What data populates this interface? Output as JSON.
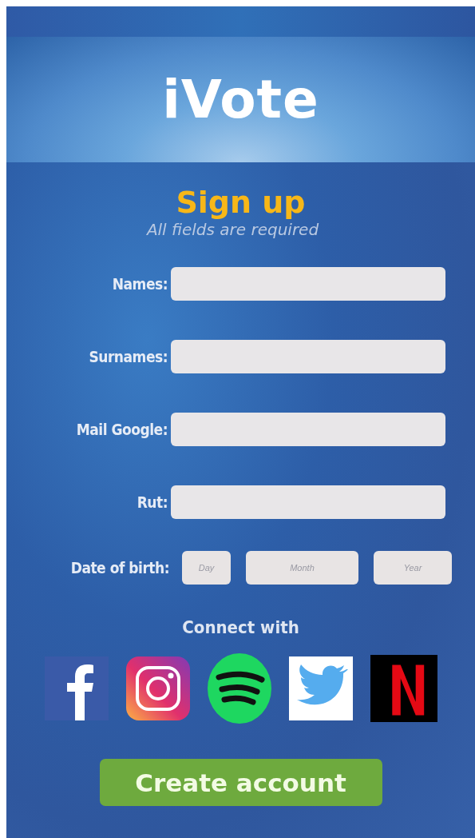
{
  "logo": {
    "text": "iVote"
  },
  "heading": "Sign up",
  "subtitle": "All fields are required",
  "fields": [
    {
      "label": "Names:"
    },
    {
      "label": "Surnames:"
    },
    {
      "label": "Mail Google:"
    },
    {
      "label": "Rut:"
    }
  ],
  "birth_date": {
    "label": "Date of birth:",
    "parts": [
      {
        "placeholder": "Day",
        "kind": "small"
      },
      {
        "placeholder": "Month",
        "kind": "wide"
      },
      {
        "placeholder": "Year",
        "kind": "medium"
      }
    ]
  },
  "connect": {
    "label": "Connect with",
    "services": [
      {
        "kind": "letterf"
      },
      {
        "kind": "camera"
      },
      {
        "kind": "waves"
      },
      {
        "kind": "bird"
      },
      {
        "kind": "lettern"
      }
    ]
  },
  "submit": {
    "label": "Create account"
  }
}
